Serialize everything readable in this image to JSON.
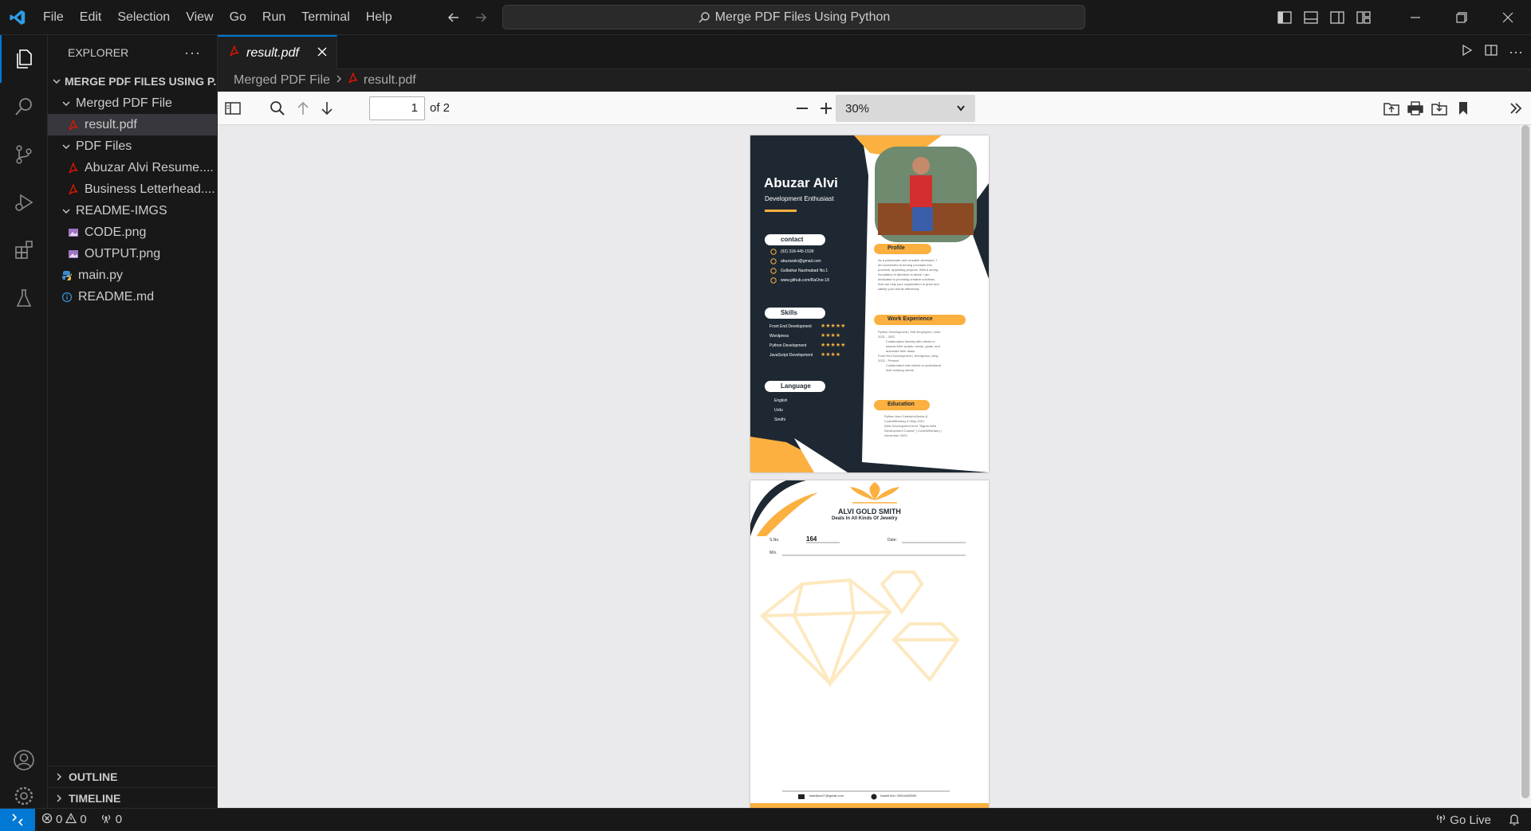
{
  "titlebar": {
    "menu": [
      "File",
      "Edit",
      "Selection",
      "View",
      "Go",
      "Run",
      "Terminal",
      "Help"
    ],
    "search": "Merge PDF Files Using Python"
  },
  "sidebar": {
    "header": "EXPLORER",
    "root": "MERGE PDF FILES USING P...",
    "items": [
      {
        "label": "Merged PDF File",
        "type": "folder"
      },
      {
        "label": "result.pdf",
        "type": "pdf"
      },
      {
        "label": "PDF Files",
        "type": "folder"
      },
      {
        "label": "Abuzar Alvi Resume....",
        "type": "pdf"
      },
      {
        "label": "Business Letterhead....",
        "type": "pdf"
      },
      {
        "label": "README-IMGS",
        "type": "folder"
      },
      {
        "label": "CODE.png",
        "type": "image"
      },
      {
        "label": "OUTPUT.png",
        "type": "image"
      },
      {
        "label": "main.py",
        "type": "python"
      },
      {
        "label": "README.md",
        "type": "info"
      }
    ],
    "outline": "OUTLINE",
    "timeline": "TIMELINE"
  },
  "editor": {
    "tab_label": "result.pdf",
    "breadcrumb": [
      "Merged PDF File",
      "result.pdf"
    ]
  },
  "pdf_toolbar": {
    "page": "1",
    "page_count": "of 2",
    "zoom": "30%"
  },
  "resume": {
    "name": "Abuzar Alvi",
    "title": "Development Enthusiast",
    "contact_heading": "contact",
    "contact": [
      "(92) 318-445-1539",
      "abuzaralvi@gmail.com",
      "Gulbahar Nazimabad No.1",
      "www.github.com/RaOne-18"
    ],
    "skills_heading": "Skills",
    "skills": [
      "Front End Development",
      "Wordpress",
      "Python Development",
      "JavaScript Development"
    ],
    "stars": [
      "★★★★★",
      "★★★★",
      "★★★★★",
      "★★★★"
    ],
    "language_heading": "Language",
    "languages": [
      "English",
      "Urdu",
      "Sindhi"
    ],
    "profile_heading": "Profile",
    "profile_text": [
      "As a passionate and versatile developer, I",
      "am successful at turning concepts into",
      "practical, appealing projects. With a strong",
      "foundation in attention to detail, I am",
      "dedicated to providing creative solutions",
      "that can help your organization to grow and",
      "satisfy your clients effectively."
    ],
    "work_heading": "Work Experience",
    "work_text": [
      "Python Development | Self-Employed | June",
      "2021 - 2022",
      "Collaborated directly with clients to",
      "assess their scripts, needs, goals, and",
      "automate their tasks.",
      "Front End Development | Wordpress | May",
      "2022 - Present",
      "Collaborated with clients to understand",
      "their working needs."
    ],
    "education_heading": "Education",
    "education_text": [
      "Python from GeeksforGeeks &",
      "CodeWithHarry in May 2021",
      "Web Development from \"Sigma Web",
      "Development Course\" | CodeWithHarry |",
      "November 2023"
    ]
  },
  "letterhead": {
    "company": "ALVI GOLD SMITH",
    "tagline": "Deals In All Kinds Of Jewelry",
    "sno_label": "S.No.",
    "sno_value": "164",
    "date_label": "Date:",
    "ms_label": "M/s.",
    "email": "kashifpro27@gmail.com",
    "phone": "Kashif Alvi: 03004445509"
  },
  "statusbar": {
    "errors": "0",
    "warnings": "0",
    "ports": "0",
    "golive": "Go Live"
  },
  "colors": {
    "accent": "#0078d4",
    "resume_dark": "#1e2832",
    "resume_orange": "#fbb040",
    "pdf_red": "#e51400"
  }
}
